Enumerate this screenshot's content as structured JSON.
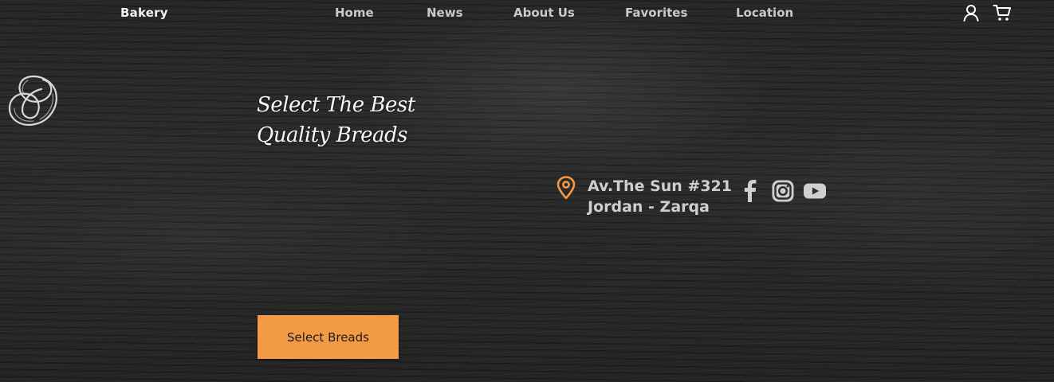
{
  "header": {
    "brand": "Bakery",
    "nav": [
      "Home",
      "News",
      "About Us",
      "Favorites",
      "Location"
    ],
    "icons": [
      "user-icon",
      "cart-icon"
    ]
  },
  "hero": {
    "logo_icon": "pretzel-icon",
    "title_line1": "Select The Best",
    "title_line2": "Quality Breads",
    "cta_label": "Select Breads"
  },
  "location": {
    "icon": "location-pin-icon",
    "line1": "Av.The Sun #321",
    "line2": "Jordan - Zarqa"
  },
  "social": [
    "facebook-icon",
    "instagram-icon",
    "youtube-icon"
  ],
  "colors": {
    "accent": "#f39a44",
    "background": "#2a2a2a",
    "nav_text": "#c9c9c9",
    "title_text": "#f7f7f7"
  }
}
